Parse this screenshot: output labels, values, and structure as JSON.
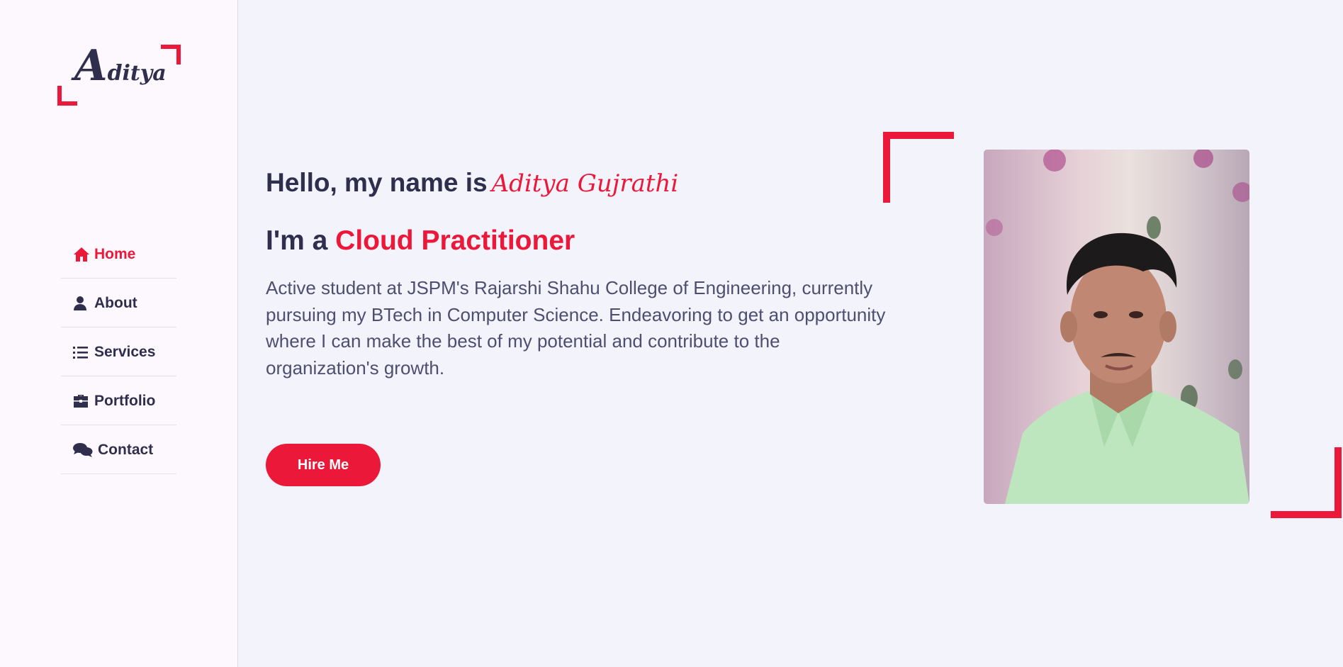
{
  "sidebar": {
    "logo": {
      "first_letter": "A",
      "rest": "ditya"
    },
    "nav": [
      {
        "label": "Home",
        "icon": "home-icon",
        "active": true
      },
      {
        "label": "About",
        "icon": "user-icon",
        "active": false
      },
      {
        "label": "Services",
        "icon": "list-icon",
        "active": false
      },
      {
        "label": "Portfolio",
        "icon": "briefcase-icon",
        "active": false
      },
      {
        "label": "Contact",
        "icon": "comments-icon",
        "active": false
      }
    ]
  },
  "home": {
    "greeting": "Hello, my name is",
    "name": "Aditya Gujrathi",
    "profession_prefix": "I'm a",
    "profession": "Cloud Practitioner",
    "bio": "Active student at JSPM's Rajarshi Shahu College of Engineering, currently pursuing my BTech in Computer Science. Endeavoring to get an opportunity where I can make the best of my potential and contribute to the organization's growth.",
    "hire_button": "Hire Me"
  },
  "colors": {
    "accent": "#ec1839",
    "text_dark": "#302e4d",
    "text_body": "#504e70",
    "background": "#f2f3fb",
    "sidebar_background": "#fcf8fd"
  }
}
